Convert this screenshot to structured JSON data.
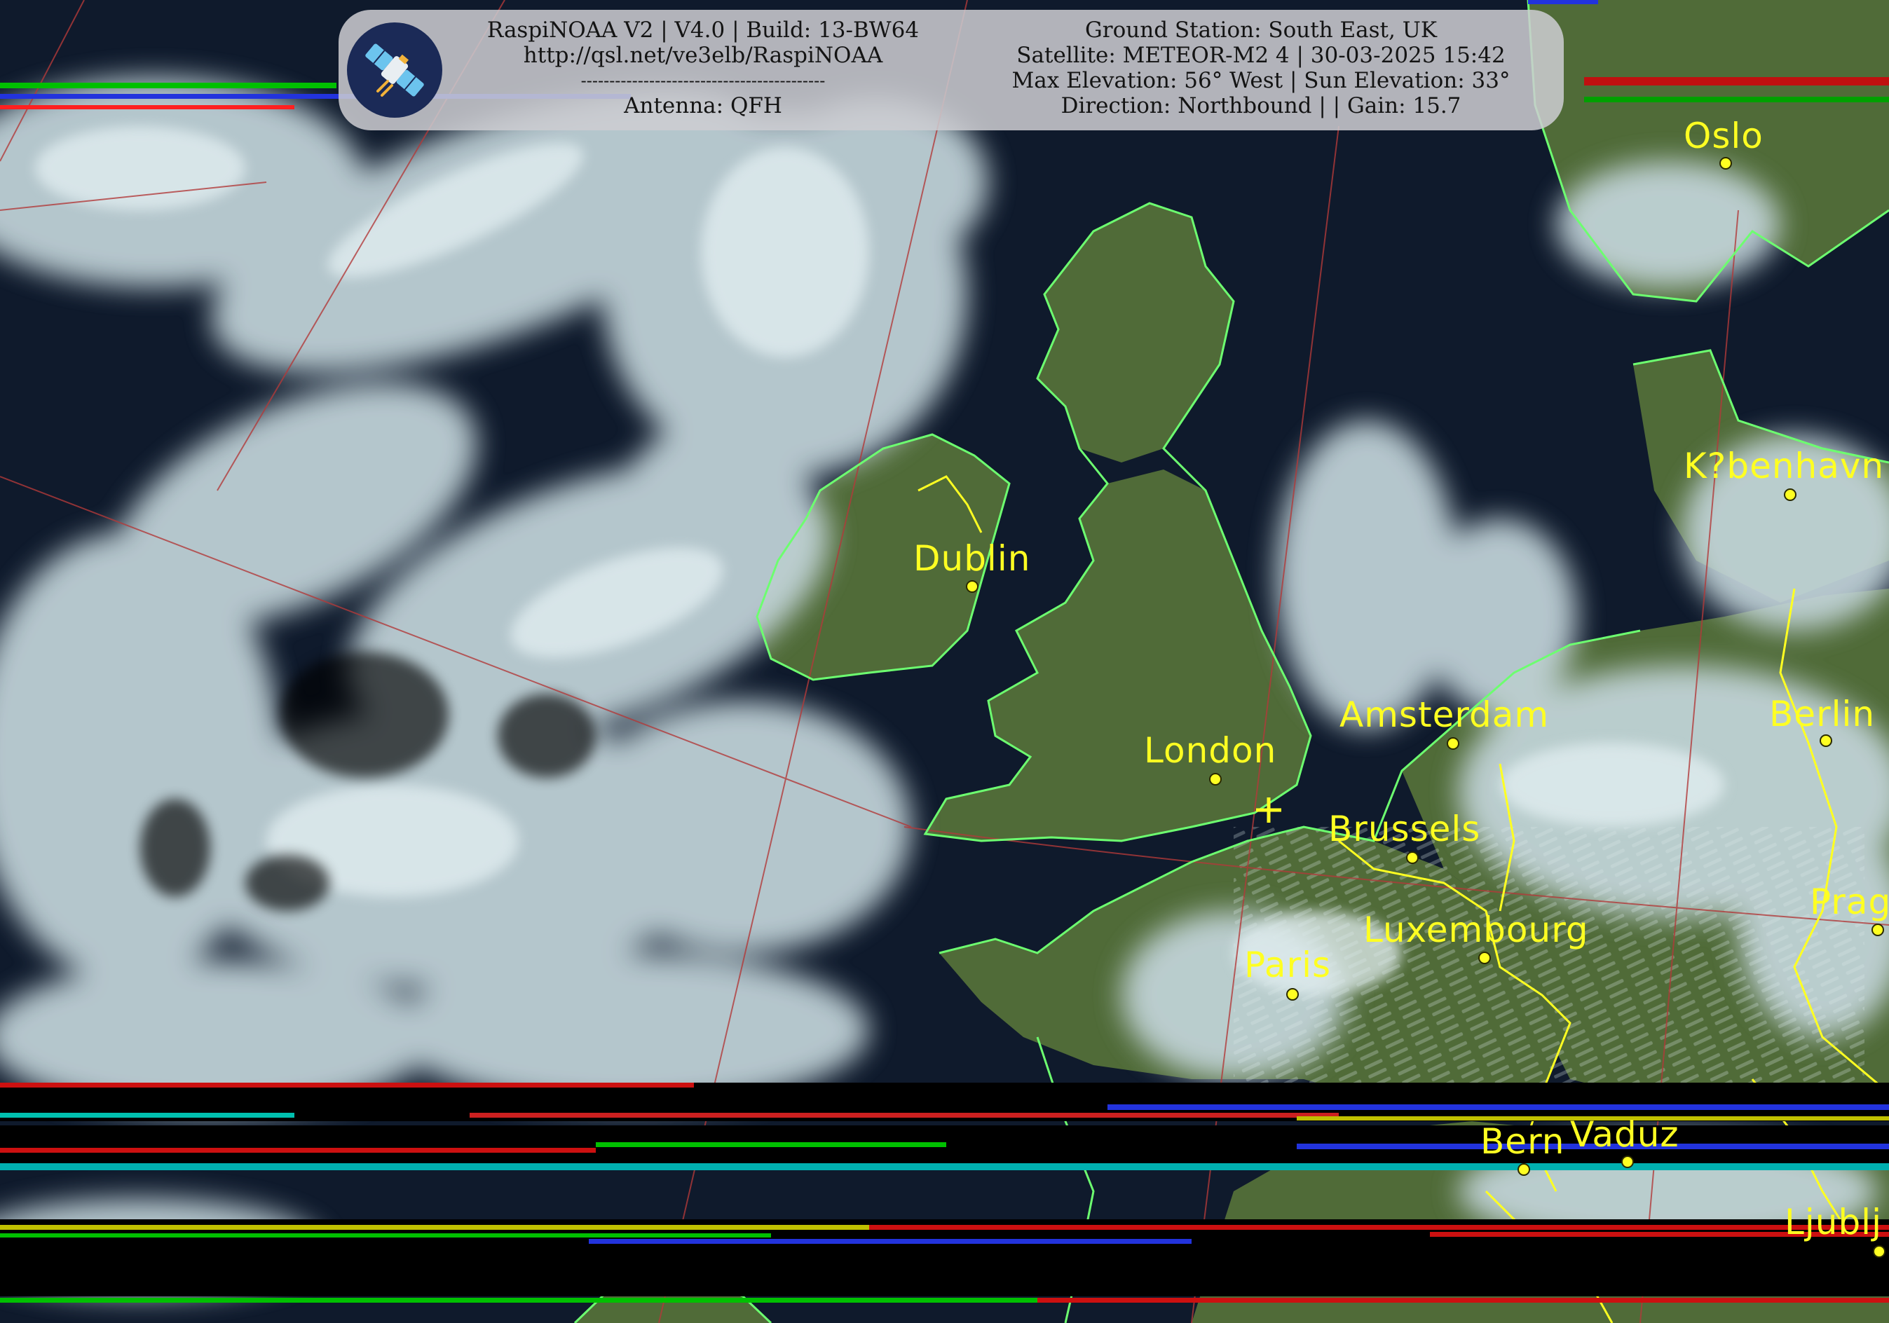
{
  "banner": {
    "software_line": "RaspiNOAA V2 | V4.0 | Build: 13-BW64",
    "url_line": "http://qsl.net/ve3elb/RaspiNOAA",
    "divider_line": "-------------------------------------------",
    "antenna_line": "Antenna: QFH",
    "station_line": "Ground Station: South East, UK",
    "satellite_line": "Satellite: METEOR-M2 4 | 30-03-2025 15:42",
    "elevation_line": "Max Elevation: 56° West | Sun Elevation: 33°",
    "direction_line": "Direction: Northbound | | Gain: 15.7"
  },
  "cities": {
    "oslo": "Oslo",
    "kobenhavn": "K?benhavn",
    "dublin": "Dublin",
    "amsterdam": "Amsterdam",
    "berlin": "Berlin",
    "london": "London",
    "brussels": "Brussels",
    "praha": "Prag",
    "luxembourg": "Luxembourg",
    "paris": "Paris",
    "bern": "Bern",
    "vaduz": "Vaduz",
    "ljubljana": "Ljublj"
  },
  "icons": {
    "logo": "satellite-icon",
    "ground_station": "crosshair-icon"
  },
  "colors": {
    "ocean": "#0f1a2c",
    "land": "#506b38",
    "cloud": "#c4d6db",
    "coastline": "#6dff70",
    "border": "#ffff22",
    "label": "#ffff22",
    "graticule": "#b23a3a"
  }
}
